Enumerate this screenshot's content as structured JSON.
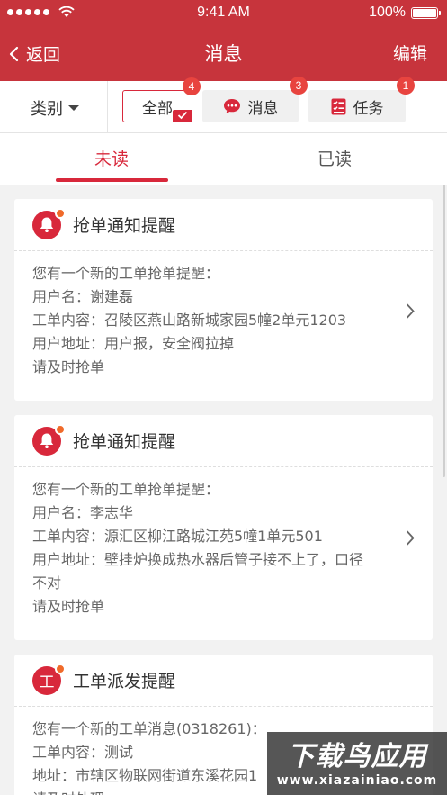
{
  "status_bar": {
    "time": "9:41 AM",
    "battery": "100%",
    "battery_level": 1.0,
    "signal_icon": "signal-dots-icon",
    "wifi_icon": "wifi-icon"
  },
  "nav": {
    "back_label": "返回",
    "title": "消息",
    "edit_label": "编辑"
  },
  "filter": {
    "category_label": "类别",
    "chips": [
      {
        "label": "全部",
        "badge": "4",
        "active": true
      },
      {
        "label": "消息",
        "badge": "3",
        "icon": "chat-bubble-icon"
      },
      {
        "label": "任务",
        "badge": "1",
        "icon": "task-list-icon"
      }
    ]
  },
  "tabs": {
    "unread": "未读",
    "read": "已读",
    "active": "unread"
  },
  "cards": [
    {
      "title": "抢单通知提醒",
      "icon": "bell-icon",
      "lines": [
        "您有一个新的工单抢单提醒：",
        "用户名：谢建磊",
        "工单内容：召陵区燕山路新城家园5幢2单元1203",
        "用户地址：用户报，安全阀拉掉",
        "请及时抢单"
      ]
    },
    {
      "title": "抢单通知提醒",
      "icon": "bell-icon",
      "lines": [
        "您有一个新的工单抢单提醒：",
        "用户名：李志华",
        "工单内容：源汇区柳江路城江苑5幢1单元501",
        "用户地址：壁挂炉换成热水器后管子接不上了，口径",
        "不对",
        "请及时抢单"
      ]
    },
    {
      "title": "工单派发提醒",
      "icon": "work-order-icon",
      "icon_char": "工",
      "lines": [
        "您有一个新的工单消息(0318261)：",
        "工单内容：测试",
        "地址：市辖区物联网街道东溪花园1",
        "请及时处理"
      ]
    }
  ],
  "watermark": {
    "top": "下载鸟应用",
    "bottom": "www.xiazainiao.com"
  },
  "colors": {
    "brand_red": "#c7343c",
    "accent_red": "#d8283b",
    "badge": "#e8443f"
  }
}
